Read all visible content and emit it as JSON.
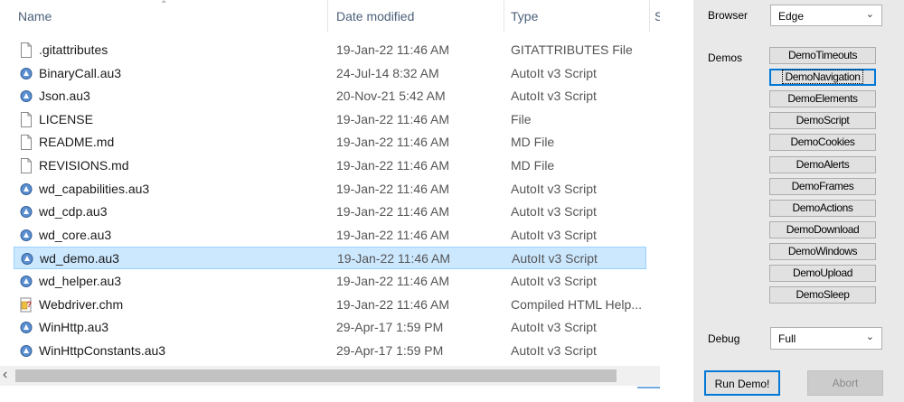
{
  "explorer": {
    "columns": {
      "name": "Name",
      "date": "Date modified",
      "type": "Type",
      "size": "S"
    },
    "files": [
      {
        "name": ".gitattributes",
        "date": "19-Jan-22 11:46 AM",
        "type": "GITATTRIBUTES File",
        "icon": "file-icon"
      },
      {
        "name": "BinaryCall.au3",
        "date": "24-Jul-14 8:32 AM",
        "type": "AutoIt v3 Script",
        "icon": "autoit-script-icon"
      },
      {
        "name": "Json.au3",
        "date": "20-Nov-21 5:42 AM",
        "type": "AutoIt v3 Script",
        "icon": "autoit-script-icon"
      },
      {
        "name": "LICENSE",
        "date": "19-Jan-22 11:46 AM",
        "type": "File",
        "icon": "file-icon"
      },
      {
        "name": "README.md",
        "date": "19-Jan-22 11:46 AM",
        "type": "MD File",
        "icon": "file-icon"
      },
      {
        "name": "REVISIONS.md",
        "date": "19-Jan-22 11:46 AM",
        "type": "MD File",
        "icon": "file-icon"
      },
      {
        "name": "wd_capabilities.au3",
        "date": "19-Jan-22 11:46 AM",
        "type": "AutoIt v3 Script",
        "icon": "autoit-script-icon"
      },
      {
        "name": "wd_cdp.au3",
        "date": "19-Jan-22 11:46 AM",
        "type": "AutoIt v3 Script",
        "icon": "autoit-script-icon"
      },
      {
        "name": "wd_core.au3",
        "date": "19-Jan-22 11:46 AM",
        "type": "AutoIt v3 Script",
        "icon": "autoit-script-icon"
      },
      {
        "name": "wd_demo.au3",
        "date": "19-Jan-22 11:46 AM",
        "type": "AutoIt v3 Script",
        "icon": "autoit-script-icon",
        "selected": true
      },
      {
        "name": "wd_helper.au3",
        "date": "19-Jan-22 11:46 AM",
        "type": "AutoIt v3 Script",
        "icon": "autoit-script-icon"
      },
      {
        "name": "Webdriver.chm",
        "date": "19-Jan-22 11:46 AM",
        "type": "Compiled HTML Help...",
        "icon": "chm-help-icon"
      },
      {
        "name": "WinHttp.au3",
        "date": "29-Apr-17 1:59 PM",
        "type": "AutoIt v3 Script",
        "icon": "autoit-script-icon"
      },
      {
        "name": "WinHttpConstants.au3",
        "date": "29-Apr-17 1:59 PM",
        "type": "AutoIt v3 Script",
        "icon": "autoit-script-icon"
      }
    ]
  },
  "form": {
    "browser_label": "Browser",
    "browser_value": "Edge",
    "demos_label": "Demos",
    "demos": [
      "DemoTimeouts",
      "DemoNavigation",
      "DemoElements",
      "DemoScript",
      "DemoCookies",
      "DemoAlerts",
      "DemoFrames",
      "DemoActions",
      "DemoDownload",
      "DemoWindows",
      "DemoUpload",
      "DemoSleep"
    ],
    "focused_demo": "DemoNavigation",
    "debug_label": "Debug",
    "debug_value": "Full",
    "run_label": "Run Demo!",
    "abort_label": "Abort"
  },
  "colors": {
    "selection": "#cce8ff",
    "accent": "#0078d7",
    "panel": "#e9e9e9"
  }
}
